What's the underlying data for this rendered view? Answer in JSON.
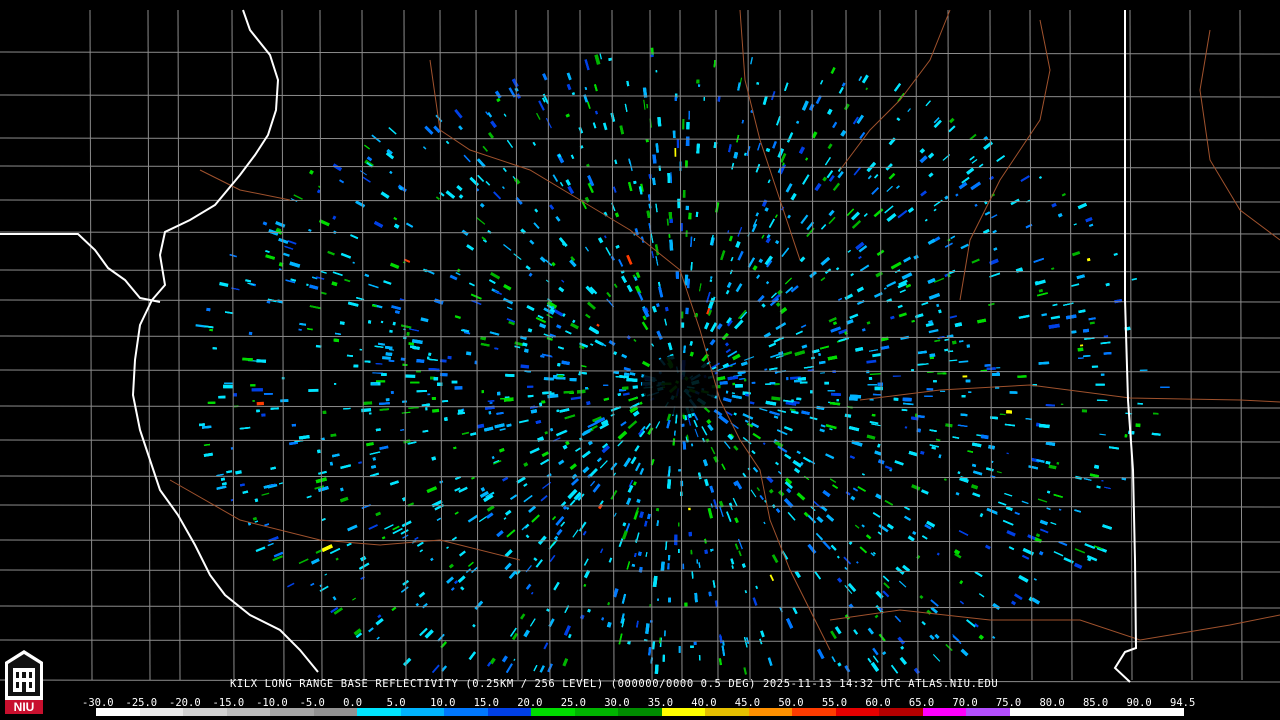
{
  "product": {
    "caption": "KILX LONG RANGE BASE REFLECTIVITY (0.25KM / 256 LEVEL) (000000/0000 0.5 DEG) 2025-11-13 14:32 UTC  ATLAS.NIU.EDU"
  },
  "logo": {
    "text": "NIU",
    "color": "#c8102e"
  },
  "colors": {
    "background": "#000000",
    "state_border": "#ffffff",
    "county_border": "#8c8c8c",
    "highway": "#a0522d"
  },
  "scale": {
    "labels": [
      "-30.0",
      "-25.0",
      "-20.0",
      "-15.0",
      "-10.0",
      "-5.0",
      "0.0",
      "5.0",
      "10.0",
      "15.0",
      "20.0",
      "25.0",
      "30.0",
      "35.0",
      "40.0",
      "45.0",
      "50.0",
      "55.0",
      "60.0",
      "65.0",
      "70.0",
      "75.0",
      "80.0",
      "85.0",
      "90.0",
      "94.5"
    ],
    "colors": [
      "#ffffff",
      "#e8e8e8",
      "#d0d0d0",
      "#bbbbbb",
      "#a6a6a6",
      "#929292",
      "#00e5ff",
      "#00b4ff",
      "#0078ff",
      "#0040e6",
      "#00dc00",
      "#00b400",
      "#008c00",
      "#ffff00",
      "#e6c000",
      "#ff9000",
      "#ff3c00",
      "#e60000",
      "#b40000",
      "#ff00ff",
      "#b450ff",
      "#ffffff",
      "#ffffff",
      "#ffffff",
      "#ffffff"
    ]
  }
}
